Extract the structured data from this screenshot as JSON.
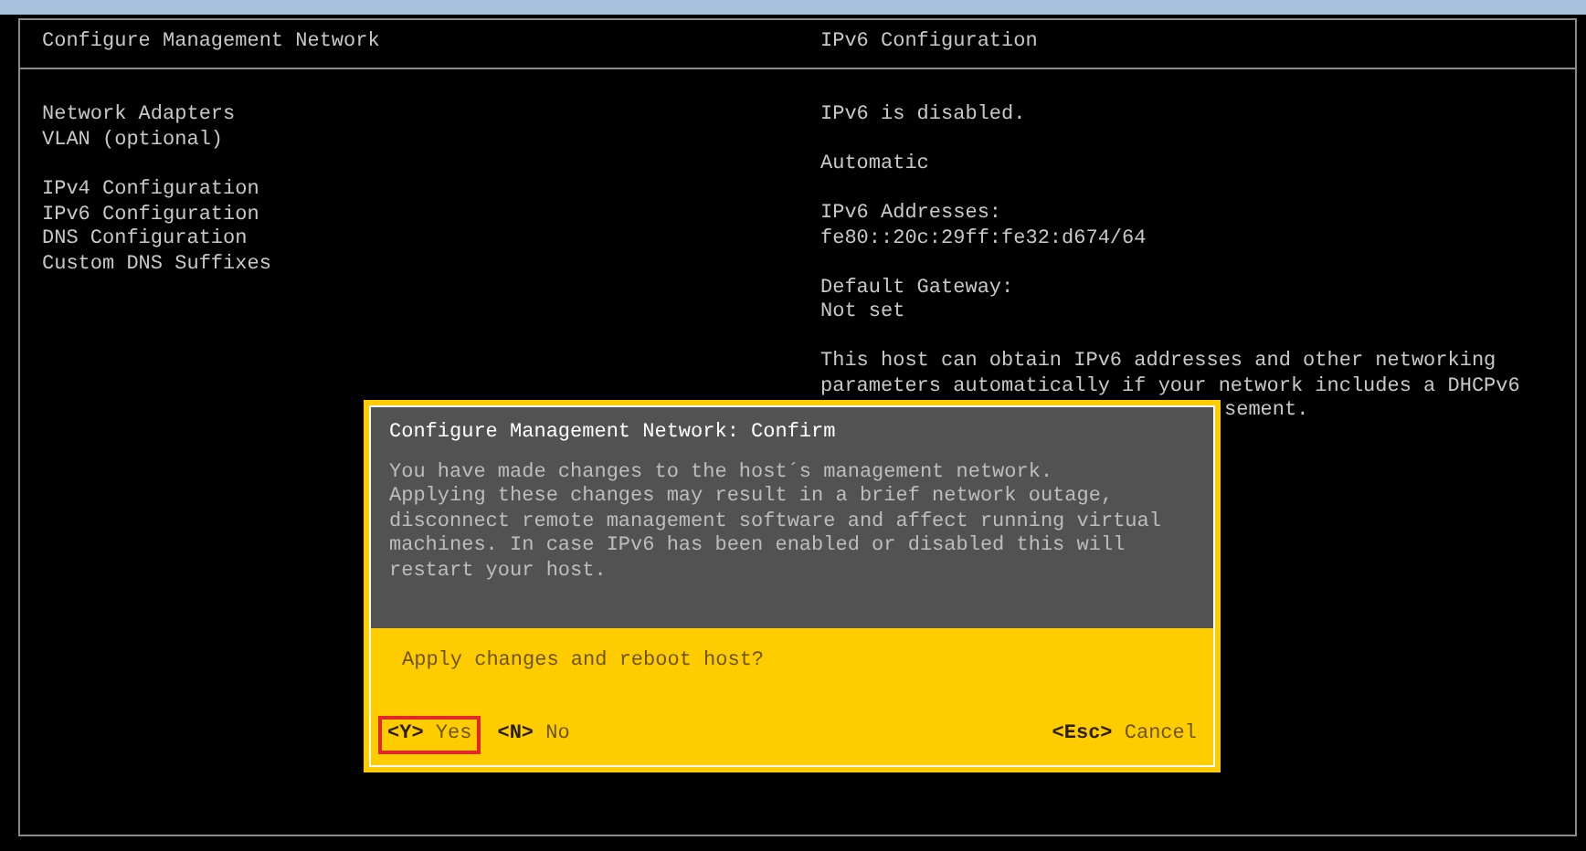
{
  "left_panel": {
    "title": "Configure Management Network",
    "menu_groups": [
      [
        "Network Adapters",
        "VLAN (optional)"
      ],
      [
        "IPv4 Configuration",
        "IPv6 Configuration",
        "DNS Configuration",
        "Custom DNS Suffixes"
      ]
    ]
  },
  "right_panel": {
    "title": "IPv6 Configuration",
    "blocks": [
      [
        "IPv6 is disabled."
      ],
      [
        "Automatic"
      ],
      [
        "IPv6 Addresses:",
        "fe80::20c:29ff:fe32:d674/64"
      ],
      [
        "Default Gateway:",
        "Not set"
      ],
      [
        "This host can obtain IPv6 addresses and other networking",
        "parameters automatically if your network includes a DHCPv6"
      ]
    ],
    "covered_fragment": "sement."
  },
  "dialog": {
    "title": "Configure Management Network: Confirm",
    "message_lines": [
      "You have made changes to the host´s management network.",
      "Applying these changes may result in a brief network outage,",
      "disconnect remote management software and affect running virtual",
      "machines. In case IPv6 has been enabled or disabled this will",
      "restart your host."
    ],
    "question": "Apply changes and reboot host?",
    "left_buttons": [
      {
        "key": "<Y>",
        "label": "Yes",
        "selected": true
      },
      {
        "key": "<N>",
        "label": "No",
        "selected": false
      }
    ],
    "right_buttons": [
      {
        "key": "<Esc>",
        "label": "Cancel",
        "selected": false
      }
    ]
  }
}
